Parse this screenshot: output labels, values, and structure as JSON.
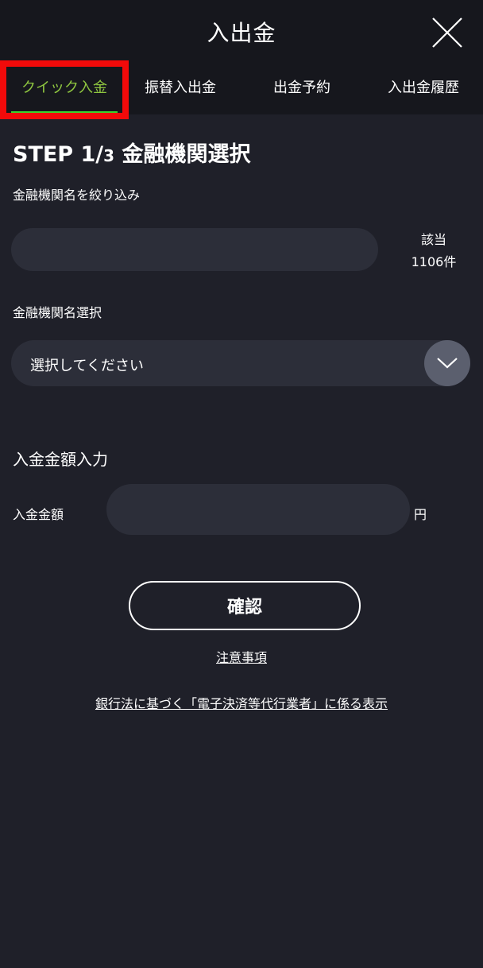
{
  "header": {
    "title": "入出金",
    "close_icon": "close-icon"
  },
  "tabs": [
    {
      "label": "クイック入金",
      "active": true
    },
    {
      "label": "振替入出金",
      "active": false
    },
    {
      "label": "出金予約",
      "active": false
    },
    {
      "label": "入出金履歴",
      "active": false
    }
  ],
  "step": {
    "prefix": "STEP 1/",
    "total": "3",
    "name": "金融機関選択"
  },
  "filter": {
    "label": "金融機関名を絞り込み",
    "value": "",
    "placeholder": "",
    "count_label": "該当",
    "count_value": "1106件"
  },
  "bank_select": {
    "label": "金融機関名選択",
    "selected": "選択してください",
    "chevron_icon": "chevron-down-icon"
  },
  "amount": {
    "section_title": "入金金額入力",
    "label": "入金金額",
    "value": "",
    "unit": "円"
  },
  "actions": {
    "confirm_label": "確認",
    "notes_link": "注意事項",
    "disclosure_link": "銀行法に基づく「電子決済等代行業者」に係る表示"
  },
  "colors": {
    "background": "#1f2029",
    "header": "#16171d",
    "active_tab": "#8fc640",
    "tab_underline": "#3bd12d",
    "highlight": "#f20a0a",
    "input_bg": "#2c2e39"
  }
}
